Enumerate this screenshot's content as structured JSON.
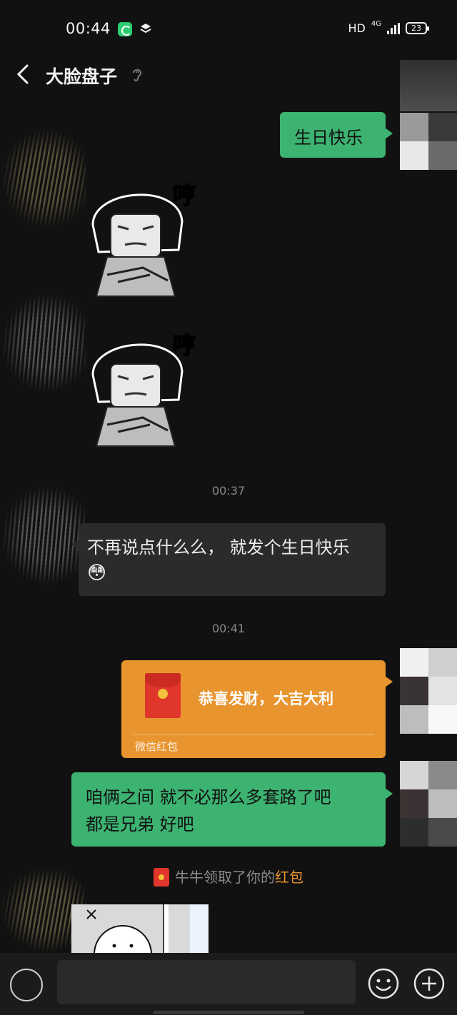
{
  "status_bar": {
    "time": "00:44",
    "network_hd": "HD",
    "network_gen": "4G",
    "battery": "23"
  },
  "header": {
    "title": "大脸盘子",
    "back_icon": "chevron-left-icon",
    "mute_icon": "ear-icon"
  },
  "messages": {
    "m1": {
      "side": "right",
      "text": "生日快乐"
    },
    "sticker1": {
      "side": "left",
      "caption": "哼"
    },
    "sticker2": {
      "side": "left",
      "caption": "哼"
    },
    "time1": "00:37",
    "m2": {
      "side": "left",
      "line1": "不再说点什么么， 就发个生日快乐",
      "emoji": "😳"
    },
    "time2": "00:41",
    "red_packet": {
      "side": "right",
      "title": "恭喜发财，大吉大利",
      "footer": "微信红包"
    },
    "m3": {
      "side": "right",
      "line1": "咱俩之间 就不必那么多套路了吧",
      "line2": "都是兄弟 好吧"
    },
    "notice": {
      "prefix": "牛牛领取了你的",
      "link": "红包"
    }
  },
  "colors": {
    "background": "#111111",
    "green_bubble": "#3cb371",
    "dark_bubble": "#2b2b2b",
    "red_packet": "#e8952f",
    "timestamp": "#8a8a8a"
  },
  "input_bar": {
    "voice_icon": "voice-icon",
    "emoji_icon": "emoji-icon",
    "plus_icon": "plus-icon"
  }
}
